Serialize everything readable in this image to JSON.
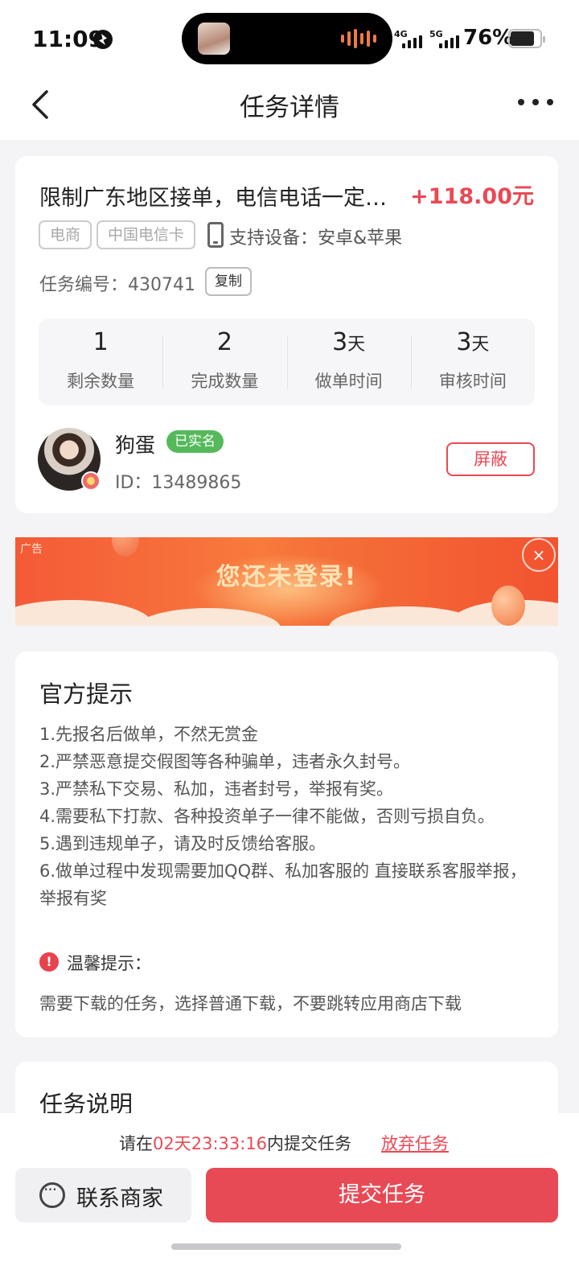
{
  "status_bar": {
    "time": "11:09",
    "network_1": "4G",
    "network_2": "5G",
    "battery": "76%"
  },
  "header": {
    "title": "任务详情"
  },
  "task": {
    "title": "限制广东地区接单，电信电话一定…",
    "price": "+118.00元",
    "tags": [
      "电商",
      "中国电信卡"
    ],
    "devices": "支持设备：安卓&苹果",
    "task_no": "任务编号：430741",
    "copy_label": "复制",
    "stats": [
      {
        "value": "1",
        "unit": "",
        "label": "剩余数量"
      },
      {
        "value": "2",
        "unit": "",
        "label": "完成数量"
      },
      {
        "value": "3",
        "unit": "天",
        "label": "做单时间"
      },
      {
        "value": "3",
        "unit": "天",
        "label": "审核时间"
      }
    ]
  },
  "publisher": {
    "name": "狗蛋",
    "verified": "已实名",
    "id": "ID：13489865",
    "block_label": "屏蔽"
  },
  "ad": {
    "label": "广告",
    "title": "您还未登录!",
    "close": "×"
  },
  "tips": {
    "heading": "官方提示",
    "items": [
      "1.先报名后做单，不然无赏金",
      "2.严禁恶意提交假图等各种骗单，违者永久封号。",
      "3.严禁私下交易、私加，违者封号，举报有奖。",
      "4.需要私下打款、各种投资单子一律不能做，否则亏损自负。",
      "5.遇到违规单子，请及时反馈给客服。",
      "6.做单过程中发现需要加QQ群、私加客服的 直接联系客服举报，举报有奖"
    ],
    "warn_icon": "!",
    "warn_title": "温馨提示：",
    "warn_text": "需要下载的任务，选择普通下载，不要跳转应用商店下载"
  },
  "description": {
    "heading": "任务说明"
  },
  "bottom": {
    "countdown_prefix": "请在",
    "countdown_time": "02天23:33:16",
    "countdown_suffix": "内提交任务",
    "abandon_label": "放弃任务",
    "contact_label": "联系商家",
    "submit_label": "提交任务"
  }
}
